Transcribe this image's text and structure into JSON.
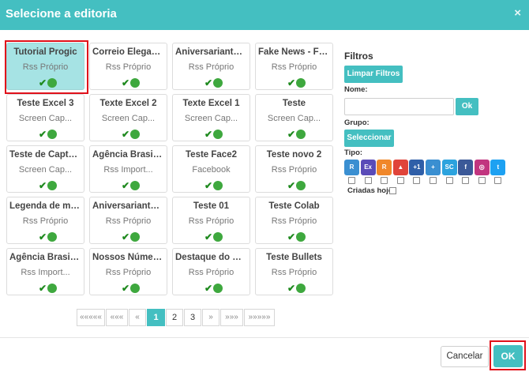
{
  "header": {
    "title": "Selecione a editoria",
    "close_label": "×"
  },
  "cards": [
    {
      "title": "Tutorial Progic",
      "subtitle": "Rss Próprio",
      "selected": true
    },
    {
      "title": "Correio Elegant...",
      "subtitle": "Rss Próprio",
      "selected": false
    },
    {
      "title": "Aniversariantes...",
      "subtitle": "Rss Próprio",
      "selected": false
    },
    {
      "title": "Fake News - Fe...",
      "subtitle": "Rss Próprio",
      "selected": false
    },
    {
      "title": "Teste Excel 3",
      "subtitle": "Screen Cap...",
      "selected": false
    },
    {
      "title": "Texte Excel 2",
      "subtitle": "Screen Cap...",
      "selected": false
    },
    {
      "title": "Texte Excel 1",
      "subtitle": "Screen Cap...",
      "selected": false
    },
    {
      "title": "Teste",
      "subtitle": "Screen Cap...",
      "selected": false
    },
    {
      "title": "Teste de Captur...",
      "subtitle": "Screen Cap...",
      "selected": false
    },
    {
      "title": "Agência Brasil - ...",
      "subtitle": "Rss Import...",
      "selected": false
    },
    {
      "title": "Teste Face2",
      "subtitle": "Facebook",
      "selected": false
    },
    {
      "title": "Teste novo 2",
      "subtitle": "Rss Próprio",
      "selected": false
    },
    {
      "title": "Legenda de mol...",
      "subtitle": "Rss Próprio",
      "selected": false
    },
    {
      "title": "Aniversariantes...",
      "subtitle": "Rss Próprio",
      "selected": false
    },
    {
      "title": "Teste 01",
      "subtitle": "Rss Próprio",
      "selected": false
    },
    {
      "title": "Teste Colab",
      "subtitle": "Rss Próprio",
      "selected": false
    },
    {
      "title": "Agência Brasil - ...",
      "subtitle": "Rss Import...",
      "selected": false
    },
    {
      "title": "Nossos Número...",
      "subtitle": "Rss Próprio",
      "selected": false
    },
    {
      "title": "Destaque do M...",
      "subtitle": "Rss Próprio",
      "selected": false
    },
    {
      "title": "Teste Bullets",
      "subtitle": "Rss Próprio",
      "selected": false
    }
  ],
  "status_check": "✔",
  "pagination": [
    {
      "label": "«««««",
      "type": "nav"
    },
    {
      "label": "«««",
      "type": "nav"
    },
    {
      "label": "«",
      "type": "nav"
    },
    {
      "label": "1",
      "type": "active"
    },
    {
      "label": "2",
      "type": "num"
    },
    {
      "label": "3",
      "type": "num"
    },
    {
      "label": "»",
      "type": "nav"
    },
    {
      "label": "»»»",
      "type": "nav"
    },
    {
      "label": "»»»»»",
      "type": "nav"
    }
  ],
  "filters": {
    "title": "Filtros",
    "clear_label": "Limpar Filtros",
    "name_label": "Nome:",
    "name_value": "",
    "ok_label": "Ok",
    "group_label": "Grupo:",
    "select_label": "Seleccionar",
    "type_label": "Tipo:",
    "created_today_label": "Criadas hoje",
    "type_icons": [
      {
        "name": "rss-imported-icon",
        "glyph": "R",
        "color": "#3a8fd1"
      },
      {
        "name": "excel-icon",
        "glyph": "Ex",
        "color": "#5a4bb8"
      },
      {
        "name": "rss-own-icon",
        "glyph": "R",
        "color": "#f0872a"
      },
      {
        "name": "birthday-cake-icon",
        "glyph": "▲",
        "color": "#e0443a"
      },
      {
        "name": "plus-one-icon",
        "glyph": "+1",
        "color": "#2f5fa8"
      },
      {
        "name": "add-user-icon",
        "glyph": "+",
        "color": "#3a8fd1"
      },
      {
        "name": "screen-capture-icon",
        "glyph": "SC",
        "color": "#2ca3de"
      },
      {
        "name": "facebook-icon",
        "glyph": "f",
        "color": "#3b5998"
      },
      {
        "name": "instagram-icon",
        "glyph": "◎",
        "color": "#c1357f"
      },
      {
        "name": "twitter-icon",
        "glyph": "t",
        "color": "#1da1f2"
      }
    ]
  },
  "footer": {
    "cancel_label": "Cancelar",
    "ok_label": "OK"
  }
}
